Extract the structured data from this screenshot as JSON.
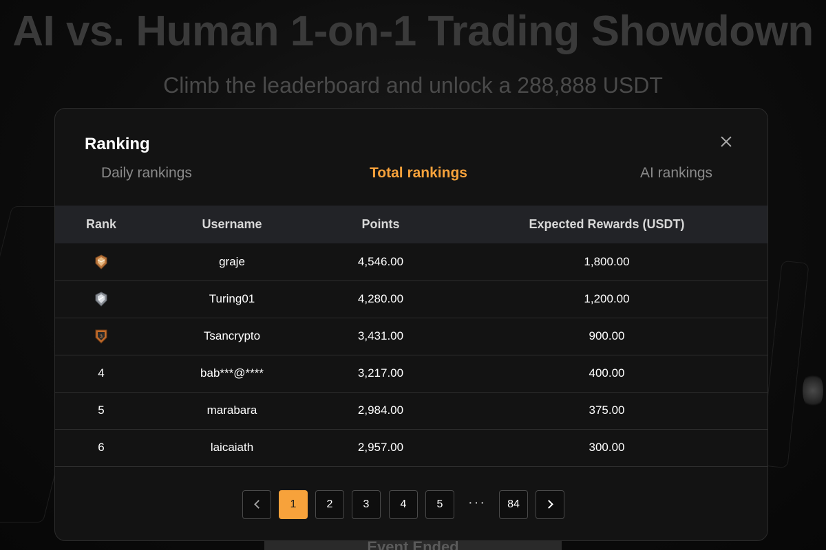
{
  "background": {
    "title": "AI vs. Human 1-on-1 Trading Showdown",
    "subtitle": "Climb the leaderboard and unlock a 288,888 USDT",
    "footer_button": "Event Ended"
  },
  "modal": {
    "title": "Ranking",
    "tabs": [
      {
        "label": "Daily rankings",
        "active": false
      },
      {
        "label": "Total rankings",
        "active": true
      },
      {
        "label": "AI rankings",
        "active": false
      }
    ],
    "columns": [
      "Rank",
      "Username",
      "Points",
      "Expected Rewards (USDT)"
    ],
    "rows": [
      {
        "rank": "1",
        "rank_icon": "gold-medal-icon",
        "username": "graje",
        "points": "4,546.00",
        "reward": "1,800.00"
      },
      {
        "rank": "2",
        "rank_icon": "silver-medal-icon",
        "username": "Turing01",
        "points": "4,280.00",
        "reward": "1,200.00"
      },
      {
        "rank": "3",
        "rank_icon": "bronze-medal-icon",
        "username": "Tsancrypto",
        "points": "3,431.00",
        "reward": "900.00"
      },
      {
        "rank": "4",
        "rank_icon": null,
        "username": "bab***@****",
        "points": "3,217.00",
        "reward": "400.00"
      },
      {
        "rank": "5",
        "rank_icon": null,
        "username": "marabara",
        "points": "2,984.00",
        "reward": "375.00"
      },
      {
        "rank": "6",
        "rank_icon": null,
        "username": "laicaiath",
        "points": "2,957.00",
        "reward": "300.00"
      }
    ],
    "pagination": {
      "pages": [
        "1",
        "2",
        "3",
        "4",
        "5"
      ],
      "ellipsis": "···",
      "last_page": "84",
      "current": "1"
    }
  },
  "colors": {
    "accent": "#f7a23b",
    "modal_bg": "#131313",
    "header_bg": "#222327"
  }
}
